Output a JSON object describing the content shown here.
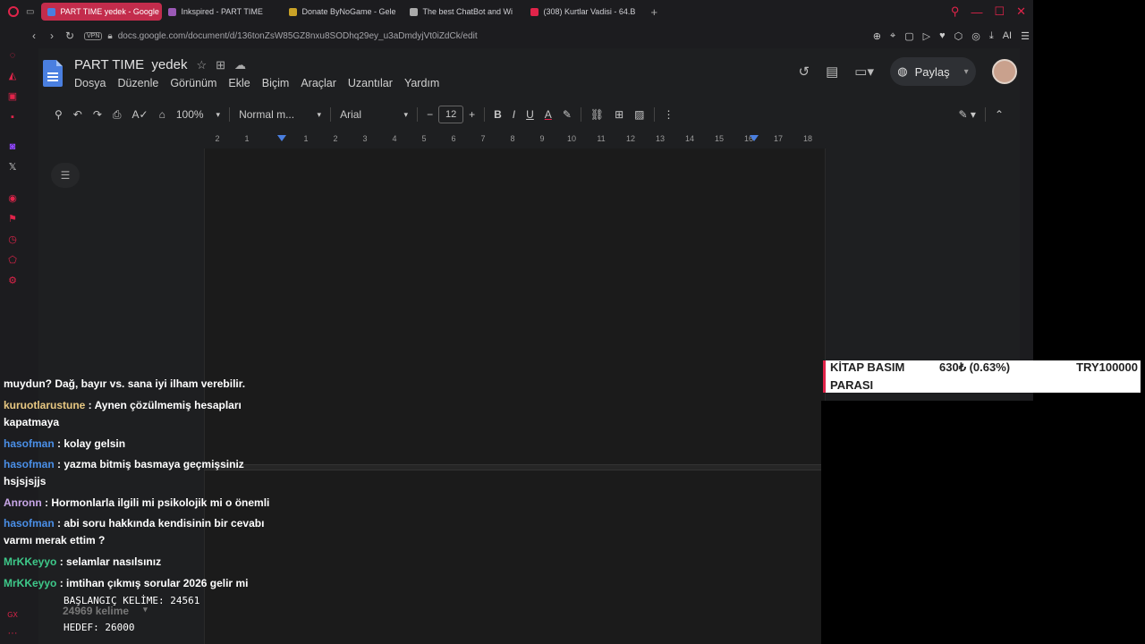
{
  "browser": {
    "tabs": [
      {
        "label": "PART TIME yedek - Google",
        "active": true,
        "favicon_color": "#4a7fe0"
      },
      {
        "label": "Inkspired - PART TIME",
        "active": false,
        "favicon_color": "#9b59b6"
      },
      {
        "label": "Donate ByNoGame - Gele",
        "active": false,
        "favicon_color": "#c9a227"
      },
      {
        "label": "The best ChatBot and Wi",
        "active": false,
        "favicon_color": "#aaaaaa"
      },
      {
        "label": "(308) Kurtlar Vadisi - 64.B",
        "active": false,
        "favicon_color": "#e0244a"
      }
    ],
    "new_tab": "+",
    "vpn": "VPN",
    "url": "docs.google.com/document/d/136tonZsW85GZ8nxu8SODhq29ey_u3aDmdyjVt0iZdCk/edit",
    "ai_label": "AI",
    "accent": "#e0244a"
  },
  "docs": {
    "title": "PART TIME  yedek",
    "menu": [
      "Dosya",
      "Düzenle",
      "Görünüm",
      "Ekle",
      "Biçim",
      "Araçlar",
      "Uzantılar",
      "Yardım"
    ],
    "share_label": "Paylaş",
    "toolbar": {
      "zoom": "100%",
      "style": "Normal m...",
      "font": "Arial",
      "font_size": "12"
    },
    "ruler_ticks": [
      "2",
      "1",
      "1",
      "2",
      "3",
      "4",
      "5",
      "6",
      "7",
      "8",
      "9",
      "10",
      "11",
      "12",
      "13",
      "14",
      "15",
      "16",
      "17",
      "18"
    ]
  },
  "chat": [
    {
      "user": "",
      "text": "muydun? Dağ, bayır vs. sana iyi ilham verebilir.",
      "color": "#ffffff"
    },
    {
      "user": "kuruotlarustune",
      "text": " : Aynen çözülmemiş hesapları kapatmaya",
      "color": "#e8c882"
    },
    {
      "user": "hasofman",
      "text": " : kolay gelsin",
      "color": "#4a8fe8"
    },
    {
      "user": "hasofman",
      "text": " : yazma bitmiş basmaya geçmişsiniz hsjsjsjjs",
      "color": "#4a8fe8"
    },
    {
      "user": "Anronn",
      "text": " : Hormonlarla ilgili mi psikolojik mi o önemli",
      "color": "#c9a7e8"
    },
    {
      "user": "hasofman",
      "text": " : abi soru hakkında kendisinin bir cevabı varmı merak ettim ?",
      "color": "#4a8fe8"
    },
    {
      "user": "MrKKeyyo",
      "text": " : selamlar nasılsınız",
      "color": "#3ec98a"
    },
    {
      "user": "MrKKeyyo",
      "text": " : imtihan çıkmış sorular 2026 gelir mi",
      "color": "#3ec98a"
    }
  ],
  "word_info": {
    "start": "BAŞLANGIÇ KELİME: 24561",
    "target": "HEDEF: 26000",
    "count": "24969 kelime"
  },
  "donation": {
    "title_line1": "KİTAP BASIM",
    "title_line2": "PARASI",
    "raised": "630₺ (0.63%)",
    "goal": "TRY100000"
  }
}
